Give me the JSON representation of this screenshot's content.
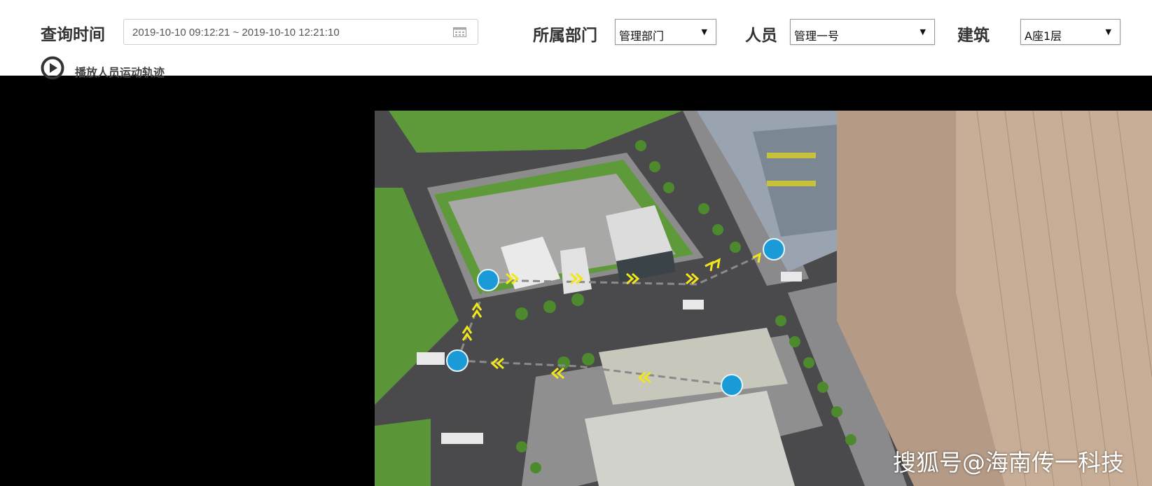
{
  "filters": {
    "time_label": "查询时间",
    "time_range": "2019-10-10 09:12:21 ~ 2019-10-10 12:21:10",
    "calendar_icon": "calendar-icon",
    "department_label": "所属部门",
    "department_value": "管理部门",
    "person_label": "人员",
    "person_value": "管理一号",
    "building_label": "建筑",
    "building_value": "A座1层",
    "dropdown_icon": "triangle-down-icon"
  },
  "playback": {
    "label": "播放人员运动轨迹",
    "icon": "play-circle-icon"
  },
  "map": {
    "watermark": "搜狐号@海南传一科技",
    "marker_color": "#1a9ad6",
    "arrow_color": "#f2e61a",
    "path_color": "#8a8a8a"
  }
}
